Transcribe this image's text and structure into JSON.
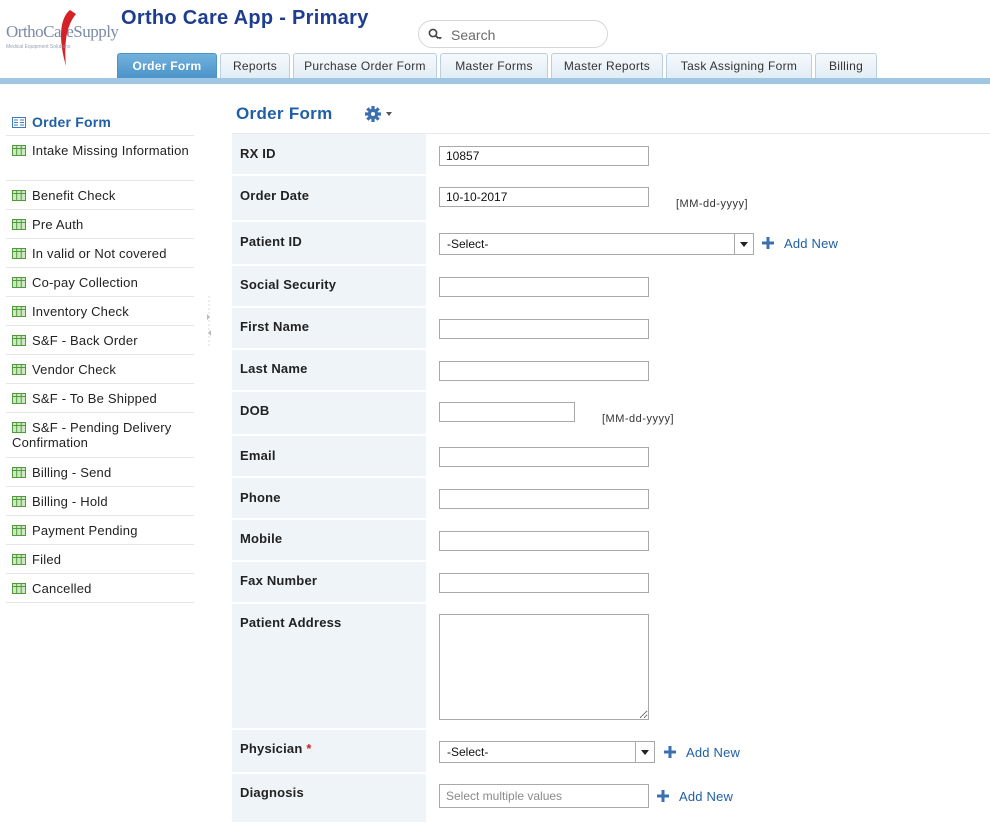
{
  "header": {
    "logo_text": "OrthoCareSupply",
    "logo_subtext": "Medical Equipment Solutions",
    "app_title": "Ortho Care App - Primary",
    "search_placeholder": "Search"
  },
  "tabs": [
    {
      "label": "Order Form",
      "active": true
    },
    {
      "label": "Reports"
    },
    {
      "label": "Purchase Order Form"
    },
    {
      "label": "Master Forms"
    },
    {
      "label": "Master Reports"
    },
    {
      "label": "Task Assigning Form"
    },
    {
      "label": "Billing"
    }
  ],
  "sidebar": {
    "items": [
      {
        "label": "Order Form",
        "active": true
      },
      {
        "label": "Intake Missing Information"
      },
      {
        "label": "Benefit Check"
      },
      {
        "label": "Pre Auth"
      },
      {
        "label": "In valid or Not covered"
      },
      {
        "label": "Co-pay Collection"
      },
      {
        "label": "Inventory Check"
      },
      {
        "label": "S&F - Back Order"
      },
      {
        "label": "Vendor Check"
      },
      {
        "label": "S&F - To Be Shipped"
      },
      {
        "label": "S&F - Pending Delivery Confirmation"
      },
      {
        "label": "Billing - Send"
      },
      {
        "label": "Billing - Hold"
      },
      {
        "label": "Payment Pending"
      },
      {
        "label": "Filed"
      },
      {
        "label": "Cancelled"
      }
    ]
  },
  "main": {
    "title": "Order Form",
    "fields": {
      "rx_id": {
        "label": "RX ID",
        "value": "10857"
      },
      "order_date": {
        "label": "Order Date",
        "value": "10-10-2017",
        "hint": "[MM-dd-yyyy]"
      },
      "patient_id": {
        "label": "Patient ID",
        "value": "-Select-",
        "add_new": "Add New"
      },
      "social_security": {
        "label": "Social Security",
        "value": ""
      },
      "first_name": {
        "label": "First Name",
        "value": ""
      },
      "last_name": {
        "label": "Last Name",
        "value": ""
      },
      "dob": {
        "label": "DOB",
        "value": "",
        "hint": "[MM-dd-yyyy]"
      },
      "email": {
        "label": "Email",
        "value": ""
      },
      "phone": {
        "label": "Phone",
        "value": ""
      },
      "mobile": {
        "label": "Mobile",
        "value": ""
      },
      "fax": {
        "label": "Fax Number",
        "value": ""
      },
      "address": {
        "label": "Patient Address",
        "value": ""
      },
      "physician": {
        "label": "Physician",
        "required_mark": "*",
        "value": "-Select-",
        "add_new": "Add New"
      },
      "diagnosis": {
        "label": "Diagnosis",
        "placeholder": "Select multiple values",
        "add_new": "Add New"
      }
    }
  },
  "colors": {
    "accent": "#1f5fa8",
    "tab_active": "#4b93c9",
    "label_bg": "#eef4f8",
    "required": "#d0202a"
  }
}
